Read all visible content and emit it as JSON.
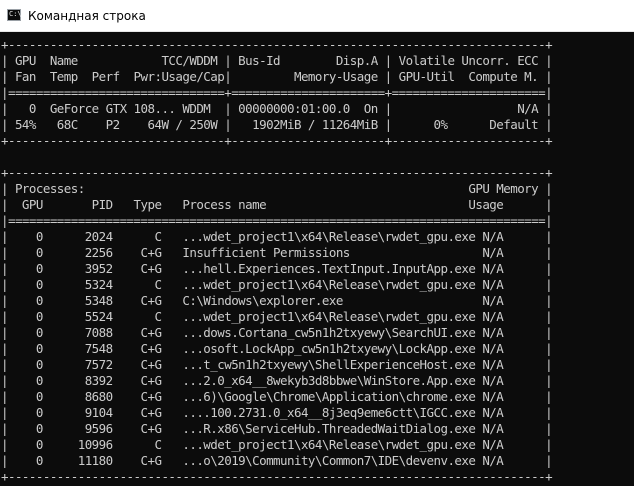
{
  "window": {
    "title": "Командная строка",
    "icon": "cmd-icon",
    "icon_glyph": "C:\\"
  },
  "terminal": {
    "text_color": "#cccccc",
    "background": "#0c0c0c",
    "lines": [
      "+-----------------------------------------------------------------------------+",
      "| GPU  Name            TCC/WDDM | Bus-Id        Disp.A | Volatile Uncorr. ECC |",
      "| Fan  Temp  Perf  Pwr:Usage/Cap|         Memory-Usage | GPU-Util  Compute M. |",
      "|===============================+======================+======================|",
      "|   0  GeForce GTX 108... WDDM  | 00000000:01:00.0  On |                  N/A |",
      "| 54%   68C    P2    64W / 250W |   1902MiB / 11264MiB |      0%      Default |",
      "+-------------------------------+----------------------+----------------------+",
      "",
      "+-----------------------------------------------------------------------------+",
      "| Processes:                                                       GPU Memory |",
      "|  GPU       PID   Type   Process name                             Usage      |",
      "|=============================================================================|",
      "|    0      2024      C   ...wdet_project1\\x64\\Release\\rwdet_gpu.exe N/A      |",
      "|    0      2256    C+G   Insufficient Permissions                   N/A      |",
      "|    0      3952    C+G   ...hell.Experiences.TextInput.InputApp.exe N/A      |",
      "|    0      5324      C   ...wdet_project1\\x64\\Release\\rwdet_gpu.exe N/A      |",
      "|    0      5348    C+G   C:\\Windows\\explorer.exe                    N/A      |",
      "|    0      5524      C   ...wdet_project1\\x64\\Release\\rwdet_gpu.exe N/A      |",
      "|    0      7088    C+G   ...dows.Cortana_cw5n1h2txyewy\\SearchUI.exe N/A      |",
      "|    0      7548    C+G   ...osoft.LockApp_cw5n1h2txyewy\\LockApp.exe N/A      |",
      "|    0      7572    C+G   ...t_cw5n1h2txyewy\\ShellExperienceHost.exe N/A      |",
      "|    0      8392    C+G   ...2.0_x64__8wekyb3d8bbwe\\WinStore.App.exe N/A      |",
      "|    0      8680    C+G   ...6)\\Google\\Chrome\\Application\\chrome.exe N/A      |",
      "|    0      9104    C+G   ....100.2731.0_x64__8j3eq9eme6ctt\\IGCC.exe N/A      |",
      "|    0      9596    C+G   ...R.x86\\ServiceHub.ThreadedWaitDialog.exe N/A      |",
      "|    0     10996      C   ...wdet_project1\\x64\\Release\\rwdet_gpu.exe N/A      |",
      "|    0     11180    C+G   ...o\\2019\\Community\\Common7\\IDE\\devenv.exe N/A      |",
      "+-----------------------------------------------------------------------------+"
    ]
  }
}
